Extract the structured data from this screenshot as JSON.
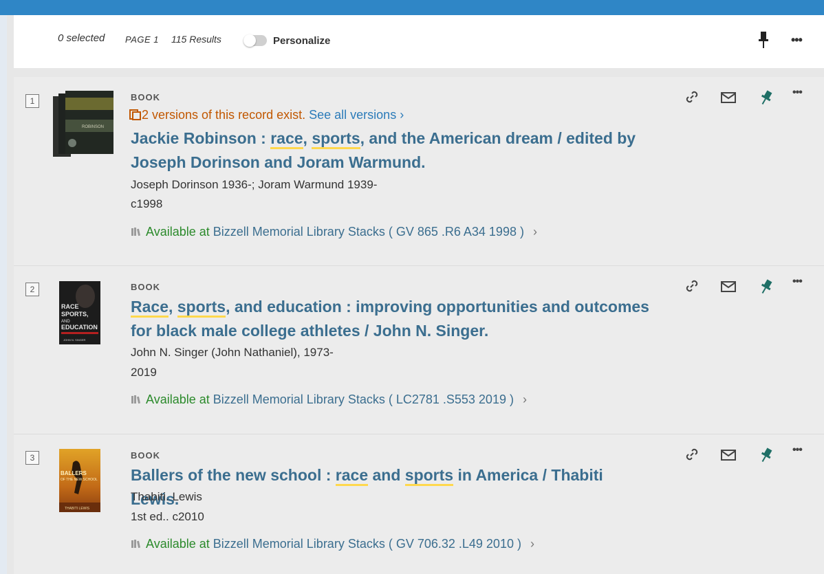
{
  "colors": {
    "top_bar": "#2f86c6",
    "title_link": "#3b6e8f",
    "available": "#2b8a2b",
    "versions": "#c15700",
    "highlight": "#ffd84d",
    "pin": "#1f6f66"
  },
  "toolbar": {
    "selected": "0 selected",
    "page": "PAGE 1",
    "results": "115 Results",
    "personalize_label": "Personalize",
    "personalize_on": false,
    "pin_icon": "pin-icon",
    "more_icon": "more-icon"
  },
  "results": [
    {
      "index": "1",
      "type": "BOOK",
      "versions_text": "2 versions of this record exist.",
      "versions_link": "See all versions",
      "title_parts": [
        {
          "t": "Jackie Robinson : ",
          "hl": false
        },
        {
          "t": "race",
          "hl": true
        },
        {
          "t": ", ",
          "hl": false
        },
        {
          "t": "sports",
          "hl": true
        },
        {
          "t": ", and the American dream / edited by Joseph Dorinson and Joram Warmund.",
          "hl": false
        }
      ],
      "author": "Joseph Dorinson 1936-; Joram Warmund 1939-",
      "date": "c1998",
      "avail_status": "Available at",
      "avail_location": "Bizzell Memorial Library  Stacks ( GV 865 .R6 A34 1998 )"
    },
    {
      "index": "2",
      "type": "BOOK",
      "title_parts": [
        {
          "t": "Race",
          "hl": true
        },
        {
          "t": ", ",
          "hl": false
        },
        {
          "t": "sports",
          "hl": true
        },
        {
          "t": ", and education : improving opportunities and outcomes for black male college athletes / John N. Singer.",
          "hl": false
        }
      ],
      "author": "John N. Singer (John Nathaniel), 1973-",
      "date": "2019",
      "avail_status": "Available at",
      "avail_location": "Bizzell Memorial Library  Stacks ( LC2781 .S553 2019 )"
    },
    {
      "index": "3",
      "type": "BOOK",
      "title_parts": [
        {
          "t": "Ballers of the new school : ",
          "hl": false
        },
        {
          "t": "race",
          "hl": true
        },
        {
          "t": " and ",
          "hl": false
        },
        {
          "t": "sports",
          "hl": true
        },
        {
          "t": " in America / Thabiti Lewis.",
          "hl": false
        }
      ],
      "author": "Thabiti. Lewis",
      "date": "1st ed.. c2010",
      "avail_status": "Available at",
      "avail_location": "Bizzell Memorial Library  Stacks ( GV 706.32 .L49 2010 )"
    }
  ],
  "covers": [
    {
      "text": "ROBINSON"
    },
    {
      "text": "RACE SPORTS, AND EDUCATION",
      "sub": "JOHN N. SINGER"
    },
    {
      "text": "BALLERS OF THE NEW SCHOOL",
      "sub": "THABITI LEWIS"
    }
  ],
  "action_icons": [
    "link-icon",
    "mail-icon",
    "pin-icon",
    "more-icon"
  ]
}
